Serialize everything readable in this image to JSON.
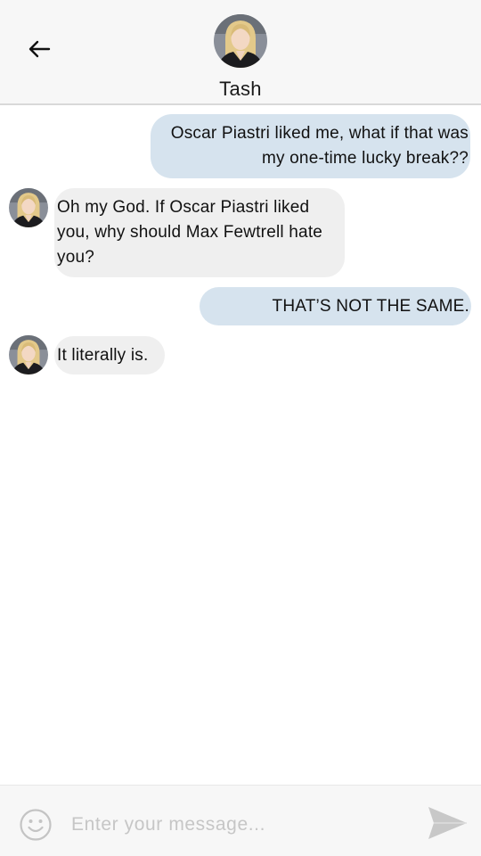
{
  "header": {
    "back_icon": "arrow-left-icon",
    "contact_name": "Tash"
  },
  "messages": [
    {
      "direction": "outgoing",
      "text": "Oscar Piastri liked me, what if that was my one-time lucky break??"
    },
    {
      "direction": "incoming",
      "text": "Oh my God. If Oscar Piastri liked you, why should Max Fewtrell hate you?"
    },
    {
      "direction": "outgoing",
      "text": "THAT’S NOT THE SAME."
    },
    {
      "direction": "incoming",
      "text": "It literally is."
    }
  ],
  "composer": {
    "emoji_icon": "smiley-icon",
    "placeholder": "Enter your message...",
    "value": "",
    "send_icon": "send-icon"
  },
  "colors": {
    "outgoing_bubble": "#d6e3ee",
    "incoming_bubble": "#efefef",
    "header_bg": "#f7f7f7"
  }
}
